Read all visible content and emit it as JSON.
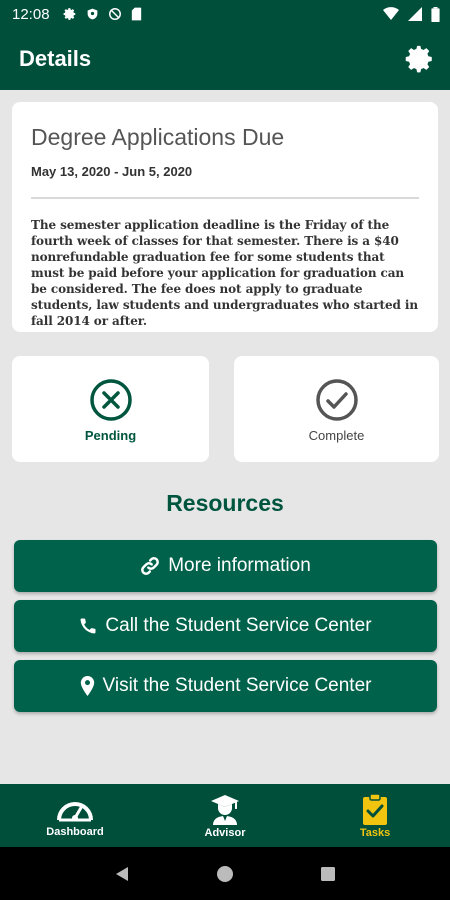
{
  "status_bar": {
    "time": "12:08",
    "left_icons": [
      "gear-icon",
      "shield-icon",
      "no-sync-icon",
      "sd-card-icon"
    ],
    "right_icons": [
      "wifi-icon",
      "signal-icon",
      "battery-icon"
    ]
  },
  "app_bar": {
    "title": "Details",
    "settings_icon": "gear-icon"
  },
  "detail": {
    "title": "Degree Applications Due",
    "dates": "May 13, 2020 - Jun 5, 2020",
    "description": "The semester application deadline is the Friday of the fourth week of classes for that semester. There is a $40 nonrefundable graduation fee for some students that must be paid before your application for graduation can be considered. The fee does not apply to graduate students, law students and undergraduates who started in fall 2014 or after."
  },
  "status_options": {
    "pending": {
      "label": "Pending",
      "icon": "circle-x-icon"
    },
    "complete": {
      "label": "Complete",
      "icon": "circle-check-icon"
    }
  },
  "resources": {
    "heading": "Resources",
    "buttons": [
      {
        "label": "More information",
        "icon": "link-icon"
      },
      {
        "label": "Call the Student Service Center",
        "icon": "phone-icon"
      },
      {
        "label": "Visit the Student Service Center",
        "icon": "map-marker-icon"
      }
    ]
  },
  "bottom_nav": {
    "items": [
      {
        "label": "Dashboard",
        "icon": "gauge-icon",
        "active": false
      },
      {
        "label": "Advisor",
        "icon": "graduate-icon",
        "active": false
      },
      {
        "label": "Tasks",
        "icon": "clipboard-check-icon",
        "active": true
      }
    ]
  },
  "colors": {
    "primary": "#004f3a",
    "button": "#00624a",
    "accent": "#f1c40f",
    "background": "#e6e6e6"
  }
}
